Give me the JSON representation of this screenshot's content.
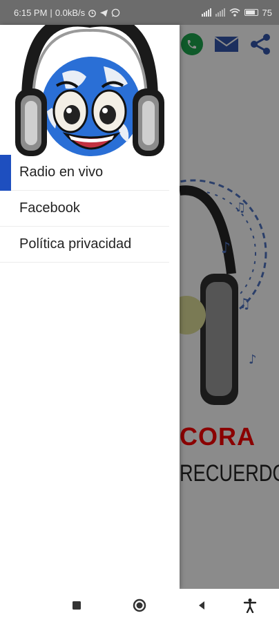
{
  "status_bar": {
    "time": "6:15 PM",
    "network_speed": "0.0kB/s",
    "icons": [
      "alarm-icon",
      "telegram-icon",
      "whatsapp-icon"
    ],
    "battery_percent": "75"
  },
  "drawer": {
    "logo": "globe-headphones-mascot",
    "menu": [
      {
        "label": "Radio en vivo",
        "active": true
      },
      {
        "label": "Facebook",
        "active": false
      },
      {
        "label": "Política privacidad",
        "active": false
      }
    ],
    "accent_color": "#1e4fbf"
  },
  "background_app": {
    "toolbar_icons": [
      "whatsapp-icon",
      "mail-icon",
      "share-icon"
    ],
    "banner_text_red": "CORA",
    "banner_text_dark": "RECUERDO"
  },
  "nav_bar": {
    "buttons": [
      "recents-button",
      "home-button",
      "back-button",
      "accessibility-button"
    ]
  }
}
